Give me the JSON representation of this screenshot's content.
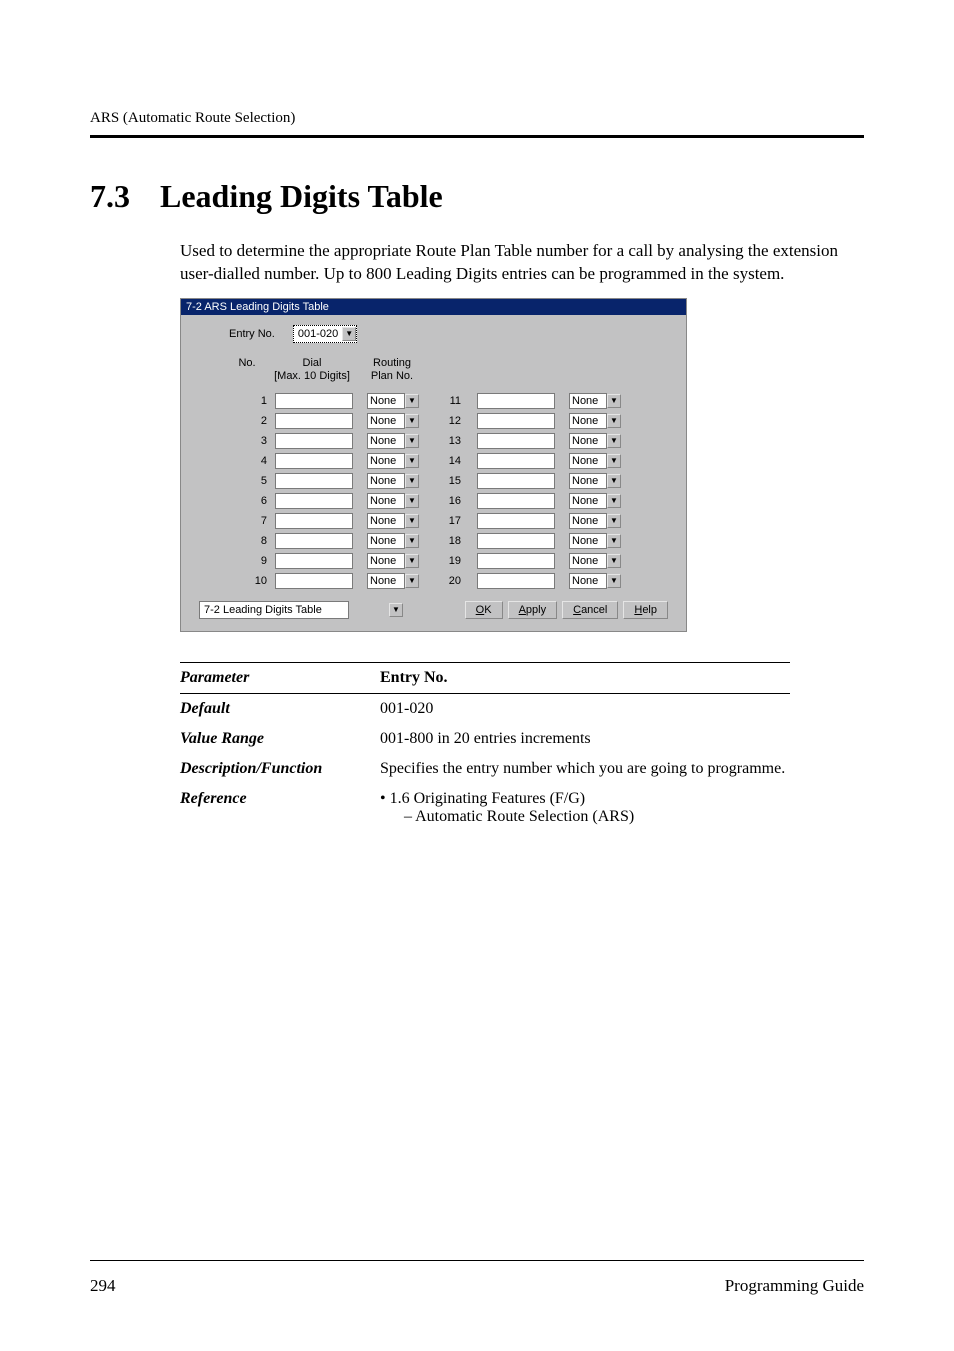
{
  "header": {
    "text": "ARS (Automatic Route Selection)"
  },
  "section": {
    "number": "7.3",
    "title": "Leading Digits Table"
  },
  "intro": "Used to determine the appropriate Route Plan Table number for a call by analysing the extension user-dialled number. Up to 800 Leading Digits entries can be programmed in the system.",
  "dialog": {
    "title": "7-2 ARS Leading Digits Table",
    "entry_label": "Entry No.",
    "entry_value": "001-020",
    "col_no": "No.",
    "col_dial_l1": "Dial",
    "col_dial_l2": "[Max. 10 Digits]",
    "col_rp_l1": "Routing",
    "col_rp_l2": "Plan No.",
    "rows": [
      {
        "n": "1",
        "rp": "None",
        "n2": "11",
        "rp2": "None"
      },
      {
        "n": "2",
        "rp": "None",
        "n2": "12",
        "rp2": "None"
      },
      {
        "n": "3",
        "rp": "None",
        "n2": "13",
        "rp2": "None"
      },
      {
        "n": "4",
        "rp": "None",
        "n2": "14",
        "rp2": "None"
      },
      {
        "n": "5",
        "rp": "None",
        "n2": "15",
        "rp2": "None"
      },
      {
        "n": "6",
        "rp": "None",
        "n2": "16",
        "rp2": "None"
      },
      {
        "n": "7",
        "rp": "None",
        "n2": "17",
        "rp2": "None"
      },
      {
        "n": "8",
        "rp": "None",
        "n2": "18",
        "rp2": "None"
      },
      {
        "n": "9",
        "rp": "None",
        "n2": "19",
        "rp2": "None"
      },
      {
        "n": "10",
        "rp": "None",
        "n2": "20",
        "rp2": "None"
      }
    ],
    "nav": "7-2 Leading Digits Table",
    "ok_u": "O",
    "ok_rest": "K",
    "apply_u": "A",
    "apply_rest": "pply",
    "cancel_u": "C",
    "cancel_rest": "ancel",
    "help_u": "H",
    "help_rest": "elp"
  },
  "params": {
    "k_param": "Parameter",
    "v_param": "Entry No.",
    "k_default": "Default",
    "v_default": "001-020",
    "k_range": "Value Range",
    "v_range": "001-800 in 20 entries increments",
    "k_desc": "Description/Function",
    "v_desc": "Specifies the entry number which you are going to programme.",
    "k_ref": "Reference",
    "v_ref_1": "• 1.6 Originating Features (F/G)",
    "v_ref_2": "– Automatic Route Selection (ARS)"
  },
  "footer": {
    "page": "294",
    "guide": "Programming Guide"
  },
  "icons": {
    "down": "▼"
  }
}
